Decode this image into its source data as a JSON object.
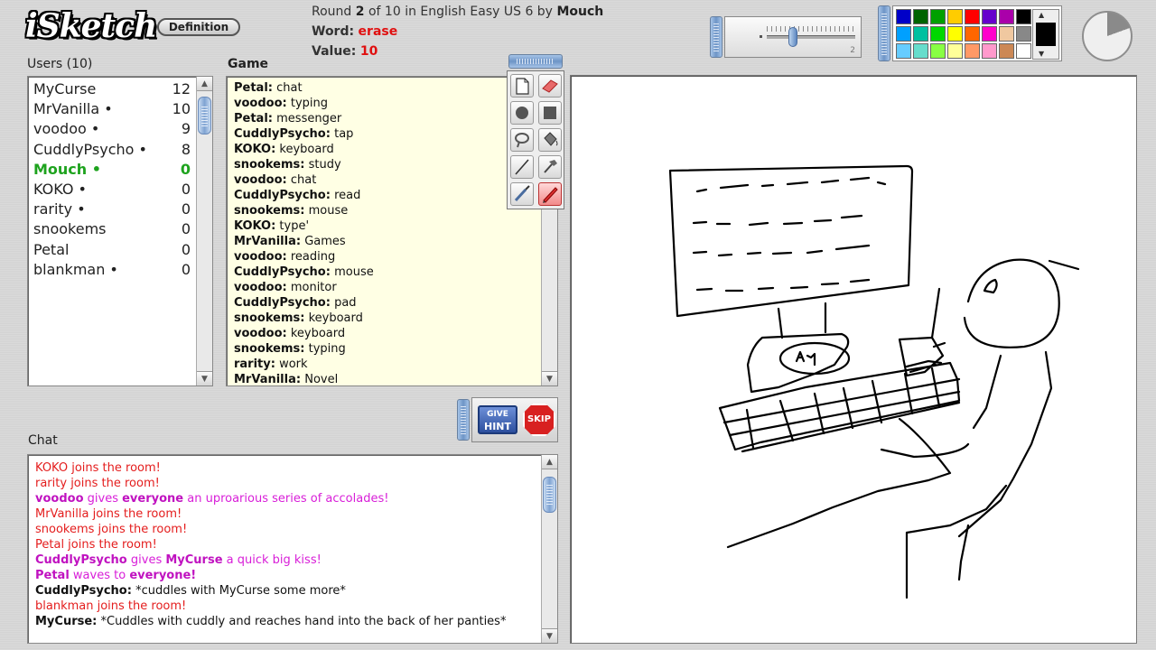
{
  "header": {
    "logo_text": "iSketch",
    "definition_button": "Definition",
    "round_prefix": "Round",
    "round_current": "2",
    "round_of": "of",
    "round_total": "10",
    "round_suffix": "in English Easy US 6 by",
    "drawer": "Mouch",
    "word_label": "Word:",
    "word": "erase",
    "value_label": "Value:",
    "value": "10"
  },
  "brush": {
    "size_label": "2",
    "size_value": 2
  },
  "palette": {
    "colors": [
      "#0000c8",
      "#006400",
      "#00a000",
      "#ffcc00",
      "#ff0000",
      "#6600cc",
      "#aa00aa",
      "#000000",
      "#00a0ff",
      "#00c0a0",
      "#00d800",
      "#ffff00",
      "#ff6600",
      "#ff00cc",
      "#f0c8a0",
      "#888888",
      "#66ccff",
      "#66ddcc",
      "#88ff44",
      "#ffff99",
      "#ff9966",
      "#ff99cc",
      "#cc8855",
      "#ffffff"
    ],
    "current_color": "#000000"
  },
  "users": {
    "heading": "Users (10)",
    "list": [
      {
        "name": "MyCurse",
        "score": "12",
        "active": false
      },
      {
        "name": "MrVanilla •",
        "score": "10",
        "active": false
      },
      {
        "name": "voodoo •",
        "score": "9",
        "active": false
      },
      {
        "name": "CuddlyPsycho •",
        "score": "8",
        "active": false
      },
      {
        "name": "Mouch •",
        "score": "0",
        "active": true
      },
      {
        "name": "KOKO •",
        "score": "0",
        "active": false
      },
      {
        "name": "rarity •",
        "score": "0",
        "active": false
      },
      {
        "name": "snookems",
        "score": "0",
        "active": false
      },
      {
        "name": "Petal",
        "score": "0",
        "active": false
      },
      {
        "name": "blankman •",
        "score": "0",
        "active": false
      }
    ]
  },
  "game": {
    "heading": "Game",
    "guesses": [
      {
        "user": "Petal:",
        "text": "chat"
      },
      {
        "user": "voodoo:",
        "text": "typing"
      },
      {
        "user": "Petal:",
        "text": "messenger"
      },
      {
        "user": "CuddlyPsycho:",
        "text": "tap"
      },
      {
        "user": "KOKO:",
        "text": "keyboard"
      },
      {
        "user": "snookems:",
        "text": "study"
      },
      {
        "user": "voodoo:",
        "text": "chat"
      },
      {
        "user": "CuddlyPsycho:",
        "text": "read"
      },
      {
        "user": "snookems:",
        "text": "mouse"
      },
      {
        "user": "KOKO:",
        "text": "type'"
      },
      {
        "user": "MrVanilla:",
        "text": "Games"
      },
      {
        "user": "voodoo:",
        "text": "reading"
      },
      {
        "user": "CuddlyPsycho:",
        "text": "mouse"
      },
      {
        "user": "voodoo:",
        "text": "monitor"
      },
      {
        "user": "CuddlyPsycho:",
        "text": "pad"
      },
      {
        "user": "snookems:",
        "text": "keyboard"
      },
      {
        "user": "voodoo:",
        "text": "keyboard"
      },
      {
        "user": "snookems:",
        "text": "typing"
      },
      {
        "user": "rarity:",
        "text": "work"
      },
      {
        "user": "MrVanilla:",
        "text": "Novel"
      }
    ]
  },
  "tools": [
    {
      "name": "new-page-tool",
      "icon": "page-icon",
      "active": false
    },
    {
      "name": "eraser-tool",
      "icon": "eraser-icon",
      "active": false
    },
    {
      "name": "circle-tool",
      "icon": "circle-icon",
      "active": false
    },
    {
      "name": "square-tool",
      "icon": "square-icon",
      "active": false
    },
    {
      "name": "lasso-tool",
      "icon": "lasso-icon",
      "active": false
    },
    {
      "name": "fill-tool",
      "icon": "bucket-icon",
      "active": false
    },
    {
      "name": "line-tool",
      "icon": "line-icon",
      "active": false
    },
    {
      "name": "hammer-tool",
      "icon": "hammer-icon",
      "active": false
    },
    {
      "name": "brush-tool",
      "icon": "brush-icon",
      "active": false
    },
    {
      "name": "pencil-tool",
      "icon": "pencil-icon",
      "active": true
    }
  ],
  "actions": {
    "hint_line1": "GIVE",
    "hint_line2": "HINT",
    "skip": "SKIP"
  },
  "chat": {
    "heading": "Chat",
    "messages": [
      {
        "style": "red",
        "parts": [
          {
            "b": false,
            "t": "KOKO joins the room!"
          }
        ]
      },
      {
        "style": "red",
        "parts": [
          {
            "b": false,
            "t": "rarity joins the room!"
          }
        ]
      },
      {
        "style": "pink",
        "parts": [
          {
            "b": true,
            "t": "voodoo"
          },
          {
            "b": false,
            "t": " gives "
          },
          {
            "b": true,
            "t": "everyone"
          },
          {
            "b": false,
            "t": " an uproarious series of accolades!"
          }
        ]
      },
      {
        "style": "red",
        "parts": [
          {
            "b": false,
            "t": "MrVanilla joins the room!"
          }
        ]
      },
      {
        "style": "red",
        "parts": [
          {
            "b": false,
            "t": "snookems joins the room!"
          }
        ]
      },
      {
        "style": "red",
        "parts": [
          {
            "b": false,
            "t": "Petal joins the room!"
          }
        ]
      },
      {
        "style": "pink",
        "parts": [
          {
            "b": true,
            "t": "CuddlyPsycho"
          },
          {
            "b": false,
            "t": " gives "
          },
          {
            "b": true,
            "t": "MyCurse"
          },
          {
            "b": false,
            "t": " a quick big kiss!"
          }
        ]
      },
      {
        "style": "pink",
        "parts": [
          {
            "b": true,
            "t": "Petal"
          },
          {
            "b": false,
            "t": " waves to "
          },
          {
            "b": true,
            "t": "everyone!"
          }
        ]
      },
      {
        "style": "black",
        "parts": [
          {
            "b": true,
            "t": "CuddlyPsycho:"
          },
          {
            "b": false,
            "t": " *cuddles with MyCurse some more*"
          }
        ]
      },
      {
        "style": "red",
        "parts": [
          {
            "b": false,
            "t": "blankman joins the room!"
          }
        ]
      },
      {
        "style": "black",
        "parts": [
          {
            "b": true,
            "t": "MyCurse:"
          },
          {
            "b": false,
            "t": " *Cuddles with cuddly and reaches hand into the back of her panties*"
          }
        ]
      }
    ]
  },
  "canvas": {
    "drawing_text": "A-n"
  }
}
